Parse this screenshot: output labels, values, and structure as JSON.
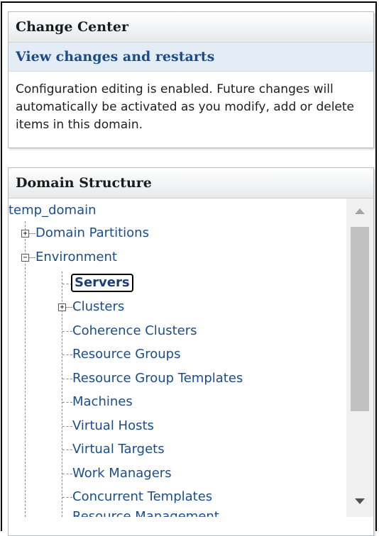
{
  "change_center": {
    "title": "Change Center",
    "link": "View changes and restarts",
    "message": "Configuration editing is enabled. Future changes will automatically be activated as you modify, add or delete items in this domain."
  },
  "domain_structure": {
    "title": "Domain Structure",
    "root": "temp_domain",
    "nodes": [
      {
        "label": "Domain Partitions",
        "expander": "+"
      },
      {
        "label": "Environment",
        "expander": "−"
      },
      {
        "label": "Servers"
      },
      {
        "label": "Clusters",
        "expander": "+"
      },
      {
        "label": "Coherence Clusters"
      },
      {
        "label": "Resource Groups"
      },
      {
        "label": "Resource Group Templates"
      },
      {
        "label": "Machines"
      },
      {
        "label": "Virtual Hosts"
      },
      {
        "label": "Virtual Targets"
      },
      {
        "label": "Work Managers"
      },
      {
        "label": "Concurrent Templates"
      },
      {
        "label": "Resource Management"
      }
    ]
  },
  "scrollbar": {
    "up_icon": "triangle-up",
    "down_icon": "triangle-down",
    "position": 0.0
  },
  "colors": {
    "link": "#1b4d8c",
    "header_bg": "#e7e9eb",
    "link_row_bg": "#e4ecf6"
  }
}
